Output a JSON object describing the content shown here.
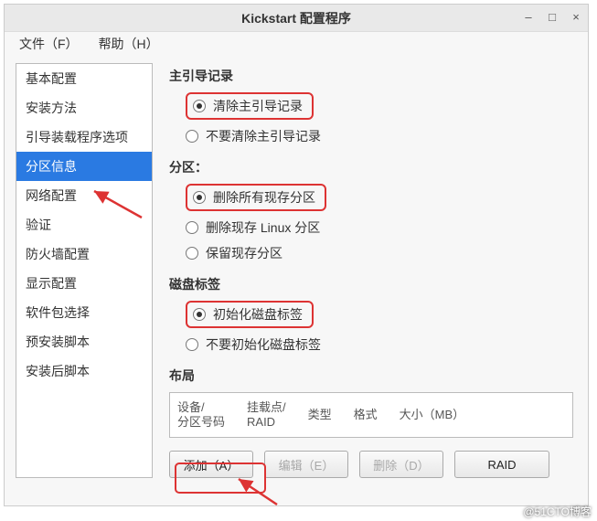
{
  "window": {
    "title": "Kickstart 配置程序"
  },
  "menu": {
    "file": "文件（F）",
    "help": "帮助（H）"
  },
  "sidebar": {
    "items": [
      {
        "label": "基本配置"
      },
      {
        "label": "安装方法"
      },
      {
        "label": "引导装载程序选项"
      },
      {
        "label": "分区信息",
        "selected": true
      },
      {
        "label": "网络配置"
      },
      {
        "label": "验证"
      },
      {
        "label": "防火墙配置"
      },
      {
        "label": "显示配置"
      },
      {
        "label": "软件包选择"
      },
      {
        "label": "预安装脚本"
      },
      {
        "label": "安装后脚本"
      }
    ]
  },
  "sections": {
    "mbr": {
      "title": "主引导记录",
      "opt1": "清除主引导记录",
      "opt2": "不要清除主引导记录",
      "selected": 1
    },
    "partition": {
      "title": "分区：",
      "opt1": "删除所有现存分区",
      "opt2": "删除现存 Linux 分区",
      "opt3": "保留现存分区",
      "selected": 1
    },
    "disklabel": {
      "title": "磁盘标签",
      "opt1": "初始化磁盘标签",
      "opt2": "不要初始化磁盘标签",
      "selected": 1
    },
    "layout": {
      "title": "布局",
      "col1a": "设备/",
      "col1b": "分区号码",
      "col2a": "挂载点/",
      "col2b": "RAID",
      "col3": "类型",
      "col4": "格式",
      "col5": "大小（MB）"
    }
  },
  "buttons": {
    "add": "添加（A）",
    "edit": "编辑（E）",
    "delete": "删除（D）",
    "raid": "RAID"
  },
  "watermark": "@51CTO博客"
}
